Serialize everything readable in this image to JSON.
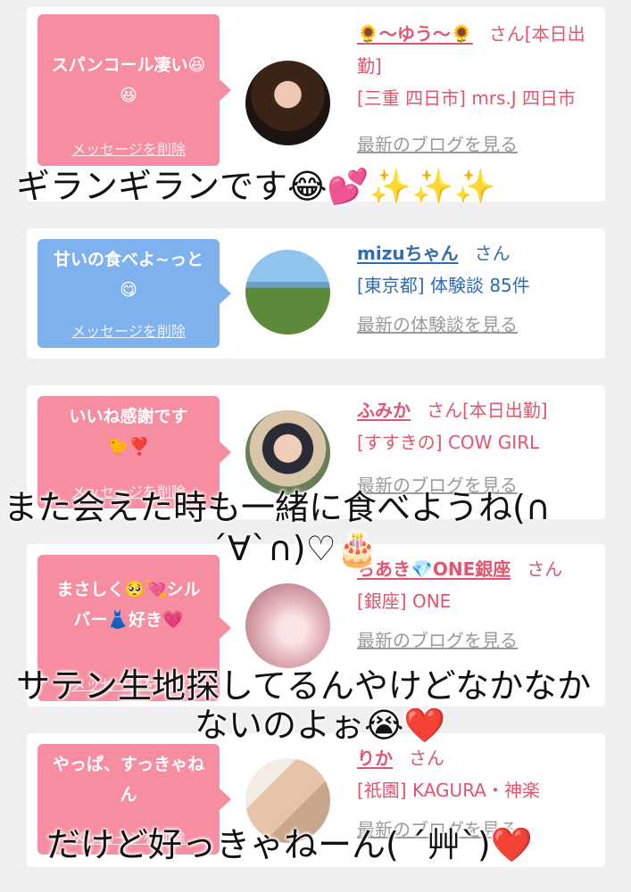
{
  "cards": [
    {
      "message": "スパンコール凄い😆😆",
      "delete_label": "メッセージを削除",
      "name": "🌻〜ゆう〜🌻",
      "honorific": "さん[本日出勤]",
      "shop": "[三重 四日市] mrs.J 四日市",
      "link": "最新のブログを見る",
      "bubble_color": "#f68da0"
    },
    {
      "message": "甘いの食べよ~っと😋",
      "delete_label": "メッセージを削除",
      "name": "mizuちゃん",
      "honorific": "さん",
      "shop": "[東京都] 体験談 85件",
      "link": "最新の体験談を見る",
      "bubble_color": "#7fb1ee"
    },
    {
      "message": "いいね感謝です🐤❣️",
      "delete_label": "メッセージを削除",
      "name": "ふみか",
      "honorific": "さん[本日出勤]",
      "shop": "[すすきの] COW GIRL",
      "link": "最新のブログを見る",
      "bubble_color": "#f68da0"
    },
    {
      "message": "まさしく🥺💘シルバー👗好き💗",
      "delete_label": "メッセージを削除",
      "name": "ちあき💎ONE銀座",
      "honorific": "さん",
      "shop": "[銀座] ONE",
      "link": "最新のブログを見る",
      "bubble_color": "#f68da0"
    },
    {
      "message": "やっぱ、すっきゃねん",
      "delete_label": "メッセージを削除",
      "name": "りか",
      "honorific": "さん",
      "shop": "[祇園] KAGURA・神楽",
      "link": "最新のブログを見る",
      "bubble_color": "#f68da0"
    }
  ],
  "overlays": {
    "line1": "ギランギランです😂💕✨✨✨",
    "line2a": "また会えた時も一緒に食べようね(∩",
    "line2b": "´∀`∩)♡🎂",
    "line3a": "サテン生地探してるんやけどなかなか",
    "line3b": "ないのよぉ😭❤️",
    "line4": "だけど好っきゃねーん( ´艸`)❤️"
  }
}
